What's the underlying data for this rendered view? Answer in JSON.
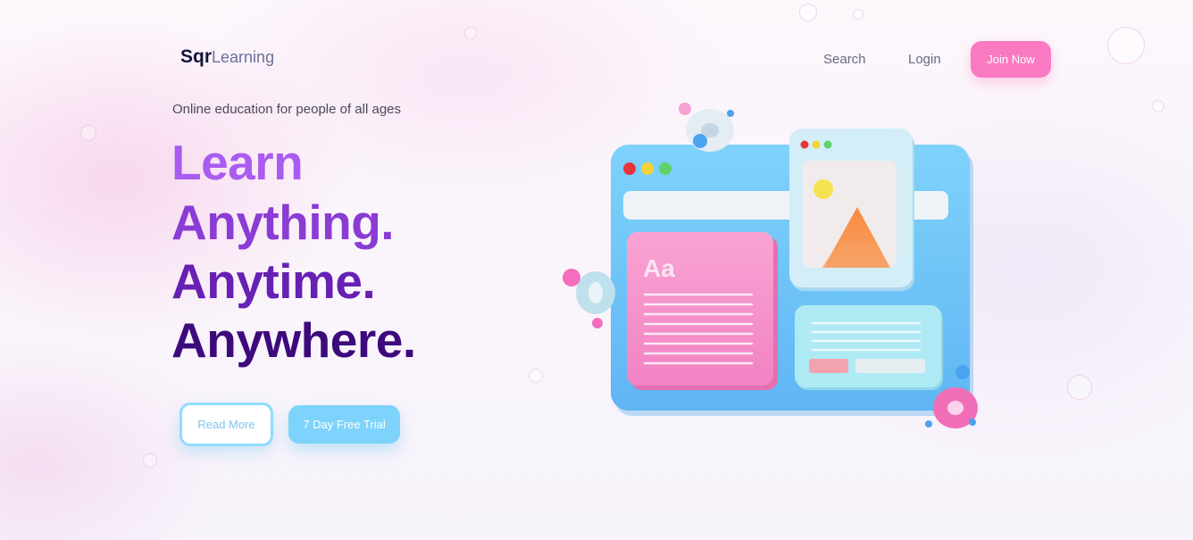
{
  "header": {
    "logo_bold": "Sqr",
    "logo_light": "Learning",
    "nav": {
      "search": "Search",
      "login": "Login",
      "join": "Join Now"
    }
  },
  "hero": {
    "tagline": "Online education for people of all ages",
    "headline": [
      "Learn",
      "Anything.",
      "Anytime.",
      "Anywhere."
    ],
    "buttons": {
      "read_more": "Read More",
      "trial": "7 Day Free Trial"
    }
  },
  "illustration": {
    "card_label": "Aa",
    "icons": [
      "browser-window-icon",
      "image-icon",
      "text-document-icon"
    ],
    "colors": {
      "window": "#6cc4f7",
      "doc": "#f48cc8",
      "accent": "#f97ac0",
      "triangle": "#f7904d"
    }
  }
}
